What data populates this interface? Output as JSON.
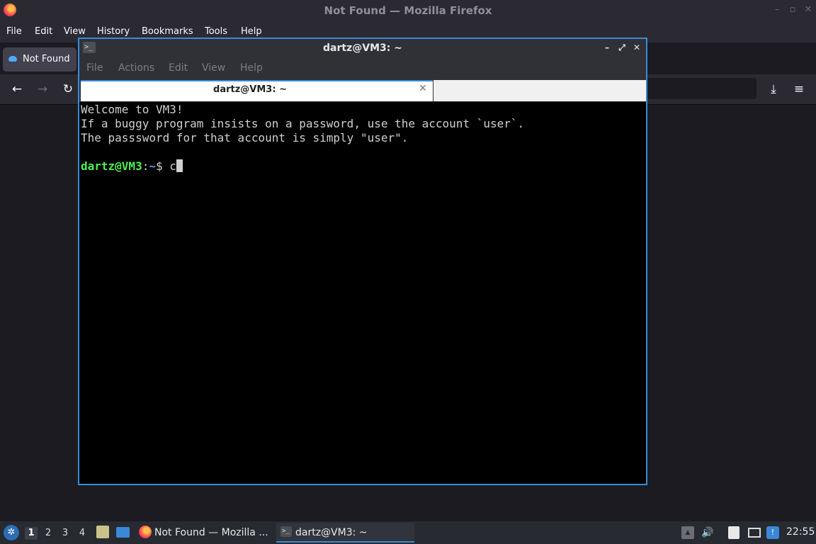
{
  "firefox": {
    "window_title": "Not Found — Mozilla Firefox",
    "menu": [
      "File",
      "Edit",
      "View",
      "History",
      "Bookmarks",
      "Tools",
      "Help"
    ],
    "tab_title": "Not Found",
    "icons": {
      "back": "back-arrow-icon",
      "forward": "forward-arrow-icon",
      "reload": "reload-icon",
      "downloads": "download-icon",
      "menu": "hamburger-menu-icon"
    }
  },
  "terminal": {
    "window_title": "dartz@VM3: ~",
    "menu": [
      "File",
      "Actions",
      "Edit",
      "View",
      "Help"
    ],
    "tab_title": "dartz@VM3: ~",
    "lines": [
      "Welcome to VM3!",
      "If a buggy program insists on a password, use the account `user`.",
      "The passsword for that account is simply \"user\"."
    ],
    "prompt": {
      "user_host": "dartz@VM3",
      "sep": ":",
      "path": "~",
      "symbol": "$ ",
      "input": "c"
    }
  },
  "taskbar": {
    "workspaces": [
      "1",
      "2",
      "3",
      "4"
    ],
    "active_workspace": "1",
    "tasks": [
      {
        "label": "Not Found — Mozilla ...",
        "icon": "firefox-icon"
      },
      {
        "label": "dartz@VM3: ~",
        "icon": "terminal-icon"
      }
    ],
    "clock": "22:55"
  },
  "colors": {
    "accent": "#3b8ad8",
    "prompt_user": "#4ff04f",
    "prompt_path": "#5c9ff0"
  }
}
